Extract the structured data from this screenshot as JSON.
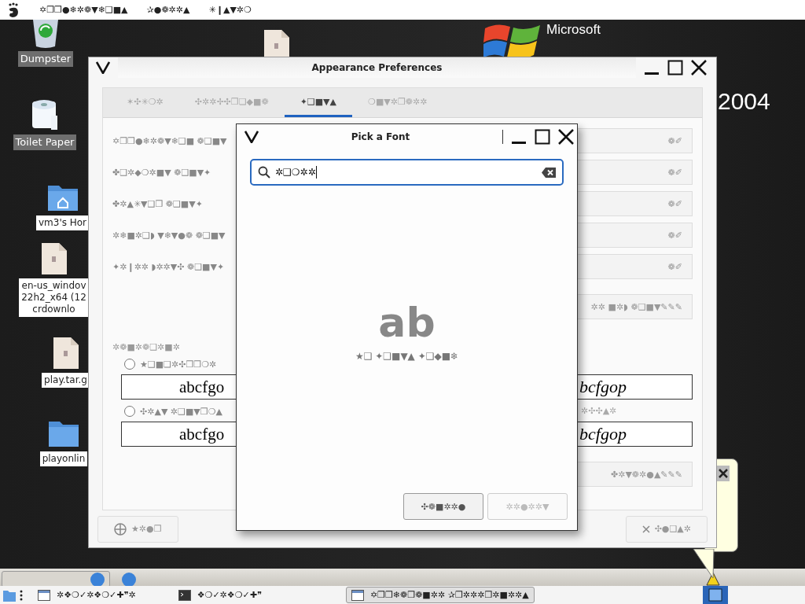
{
  "top_bar": {
    "menus": [
      "✡❒❒●❄✲❁▼❄❑■▲",
      "✰●❁✲✲▲",
      "✳❙▲▼✲❍"
    ]
  },
  "desktop": {
    "icons": [
      {
        "kind": "trash",
        "lines": [
          "Dumpster"
        ]
      },
      {
        "kind": "roll",
        "lines": [
          "Toilet Paper"
        ]
      },
      {
        "kind": "home-folder",
        "lines": [
          "vm3's Hor"
        ]
      },
      {
        "kind": "file",
        "lines": [
          "en-us_windov",
          "22h2_x64 (12",
          "crdownlo"
        ]
      },
      {
        "kind": "file",
        "lines": [
          "play.tar.g"
        ]
      },
      {
        "kind": "folder",
        "lines": [
          "playonlin"
        ]
      },
      {
        "kind": "file"
      }
    ],
    "logo": {
      "brand": "Microsoft",
      "version": "2004"
    }
  },
  "preferences": {
    "title": "Appearance Preferences",
    "tabs": [
      {
        "label": "✶✣✳❍✲",
        "selected": false
      },
      {
        "label": "✣✲✲✢✣❒❏◆■❁",
        "selected": false
      },
      {
        "label": "✦❑■▼▲",
        "selected": true
      },
      {
        "label": "❍■▼✲❒❁✲✲",
        "selected": false
      }
    ],
    "font_rows": [
      {
        "label": "✡❒❒●❄✲❁▼❄❑■ ❁❑■▼",
        "button": "❁✐"
      },
      {
        "label": "✤❑✲◆❍✲■▼ ❁❑■▼✦",
        "button": "❁✐"
      },
      {
        "label": "✤✲▲✳▼❑❒ ❁❑■▼✦",
        "button": "❁✐"
      },
      {
        "label": "✲❄■✲❑◗ ▼❄▼●❁ ❁❑■▼",
        "button": "❁✐"
      },
      {
        "label": "✦✲❙✲✲ ◗✲✲▼✣ ❁❑■▼✦",
        "button": "❁✐"
      }
    ],
    "details_button": "✲✲ ■✲◗ ❁❑■▼✎✎✎",
    "rendering": {
      "heading": "✲❁■✲❁❑✲■✲",
      "left_options": [
        {
          "label": "★❑■❏✲✣❒❒❍✲",
          "selected": false,
          "preview": "abcfgo"
        },
        {
          "label": "✣✲▲▼ ✲❑■▼❒❍▲",
          "selected": false,
          "preview": "abcfgo"
        }
      ],
      "right_options": [
        {
          "preview": "bcfgop"
        },
        {
          "label": "✲✣✣▲✲",
          "preview": "bcfgop"
        }
      ]
    },
    "rendering_details_button": "✤✲▼❁✲●▲✎✎✎",
    "help_button": "★✲●❒",
    "close_button": "✣●❑▲✲"
  },
  "font_dialog": {
    "title": "Pick a Font",
    "search": {
      "value": "✲❑❍✲✲"
    },
    "empty": {
      "icon_text": "ab",
      "message": "★❑ ✦❑■▼▲ ✦❑◆■❄"
    },
    "buttons": [
      {
        "label": "✣❁■✲✲●",
        "disabled": false
      },
      {
        "label": "✲✲●✲✲▼",
        "disabled": true
      }
    ]
  },
  "bottom_panel": {
    "windows": [
      {
        "kind": "window",
        "label": "✲❖❍✓✲❖❍✓✚❞✲",
        "selected": false
      },
      {
        "kind": "terminal",
        "label": "❖❍✓✲❖❍✓✚❞",
        "selected": false
      },
      {
        "kind": "window",
        "label": "✡❒❒❄❁❒❁■✲✲ ✰❒✲✲✲❒✲■✲✲▲",
        "selected": true
      }
    ]
  }
}
